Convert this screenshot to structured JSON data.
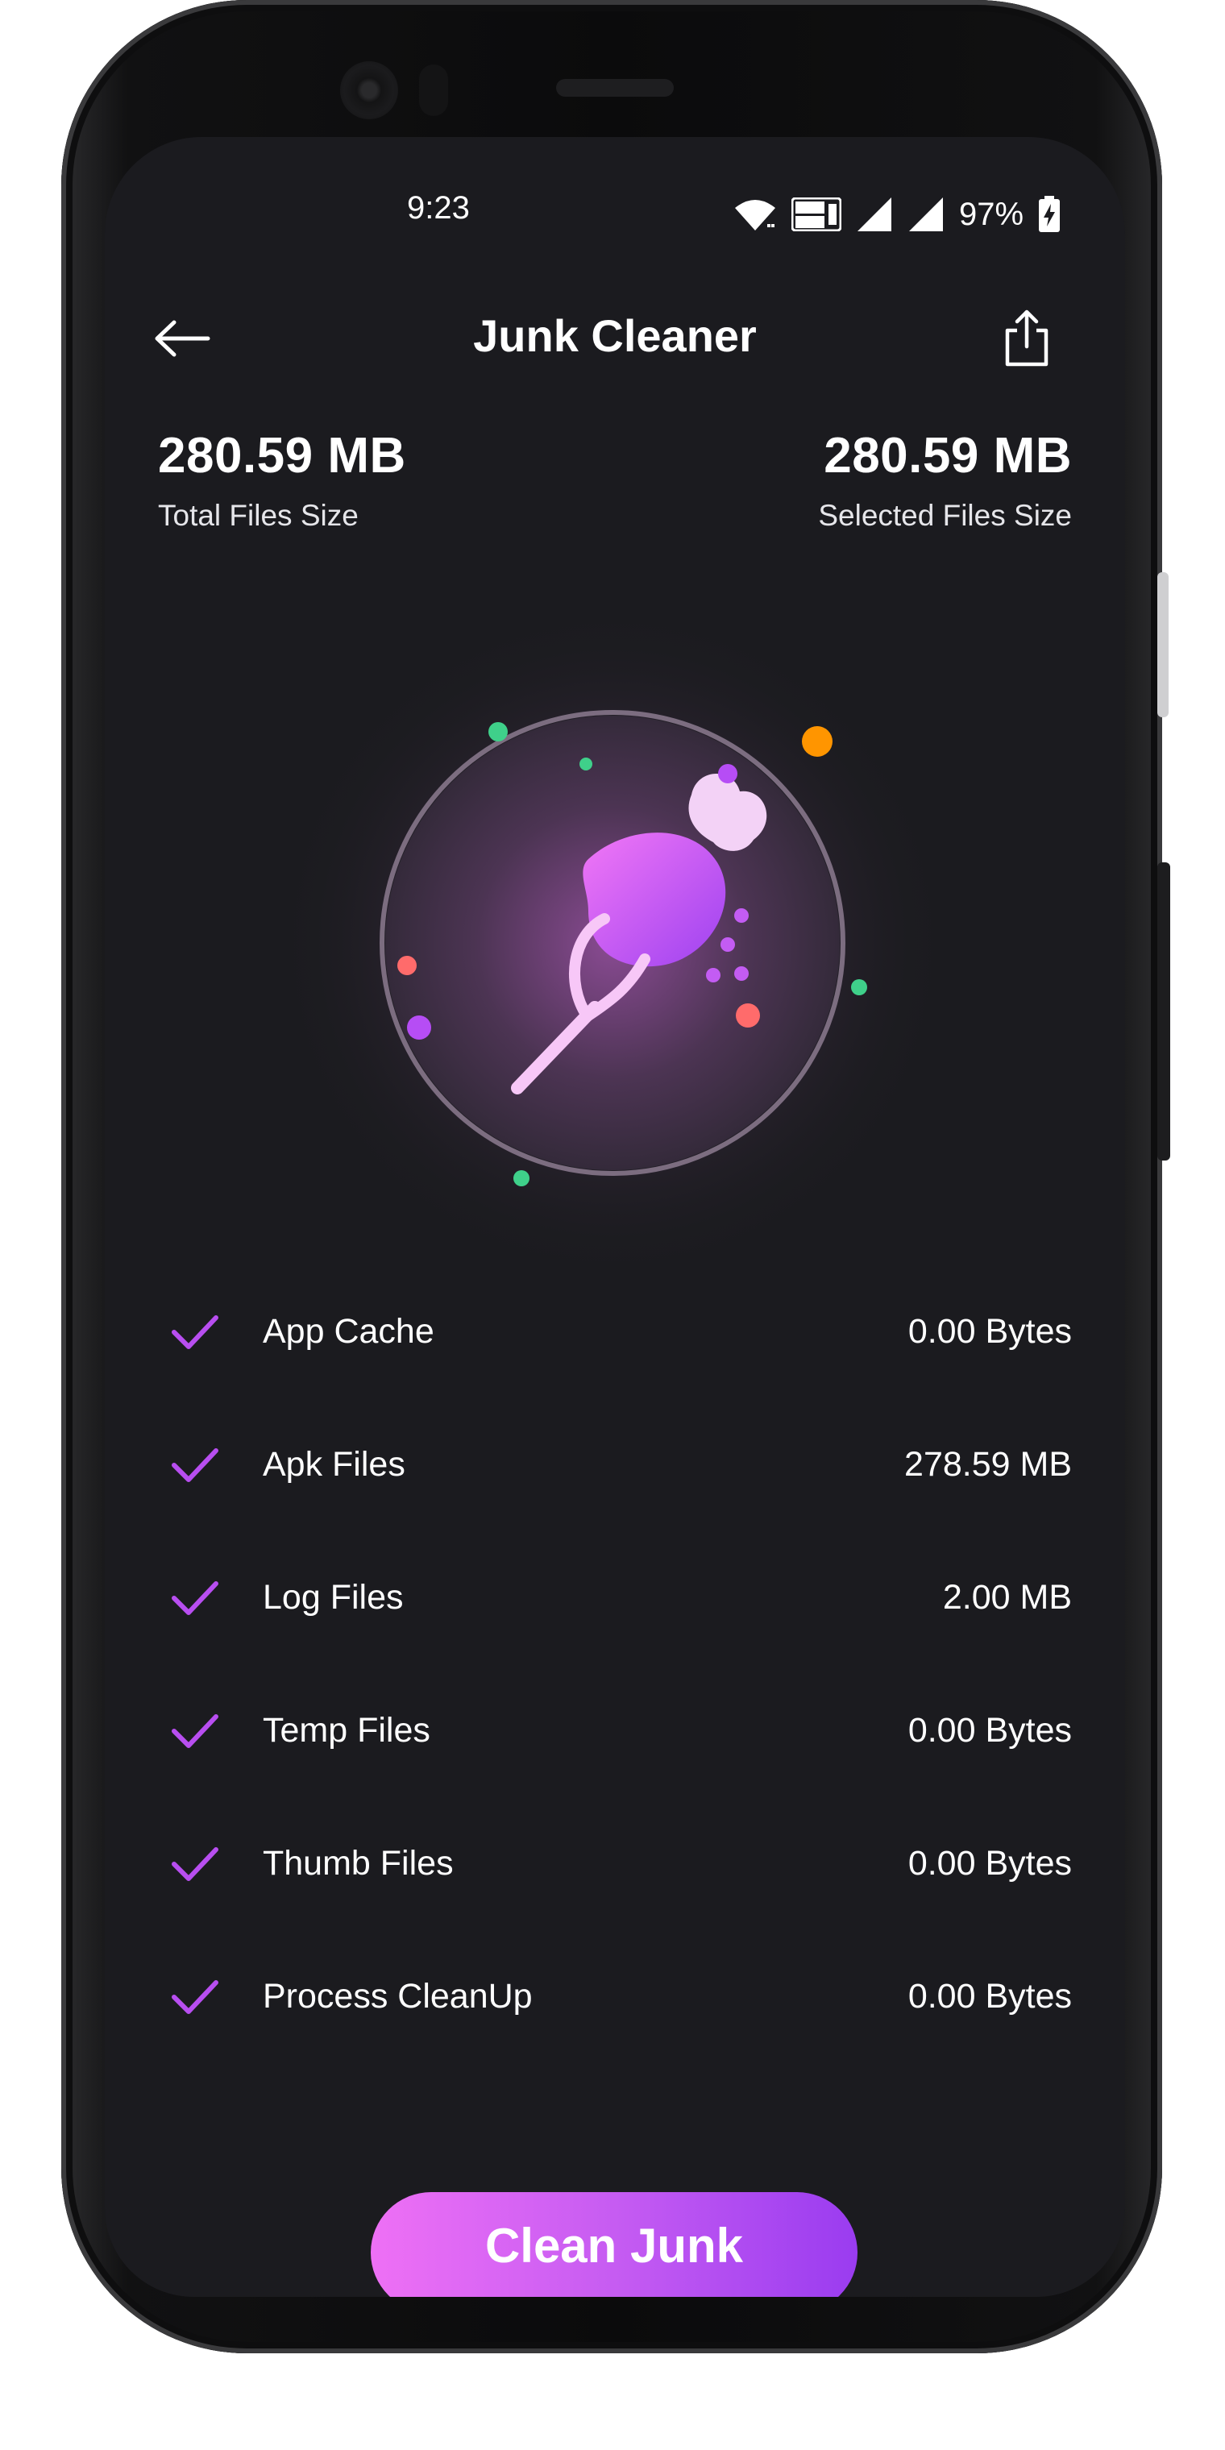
{
  "status_bar": {
    "time": "9:23",
    "battery_percent": "97%",
    "icons": [
      "wifi-icon",
      "volte-icon",
      "signal-icon",
      "signal-icon",
      "battery-charging-icon"
    ]
  },
  "header": {
    "title": "Junk Cleaner",
    "back_icon": "arrow-left-icon",
    "share_icon": "share-icon"
  },
  "summary": {
    "total_value": "280.59 MB",
    "total_label": "Total Files Size",
    "selected_value": "280.59 MB",
    "selected_label": "Selected Files Size"
  },
  "junk_items": [
    {
      "name": "App Cache",
      "size": "0.00 Bytes",
      "checked": true
    },
    {
      "name": "Apk Files",
      "size": "278.59 MB",
      "checked": true
    },
    {
      "name": "Log Files",
      "size": "2.00 MB",
      "checked": true
    },
    {
      "name": "Temp Files",
      "size": "0.00 Bytes",
      "checked": true
    },
    {
      "name": "Thumb Files",
      "size": "0.00 Bytes",
      "checked": true
    },
    {
      "name": "Process CleanUp",
      "size": "0.00 Bytes",
      "checked": true
    }
  ],
  "action": {
    "clean_label": "Clean Junk"
  },
  "colors": {
    "background": "#1b1b1f",
    "accent": "#c65cf2",
    "check": "#b84ef0",
    "dot_green": "#3fd08a",
    "dot_orange": "#ff9500",
    "dot_red": "#ff6b6b",
    "dot_purple": "#b64df5"
  }
}
